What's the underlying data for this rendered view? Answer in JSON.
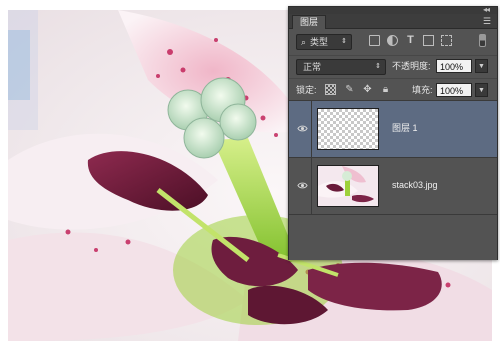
{
  "layers_panel": {
    "tab_label": "图层",
    "filter": {
      "type_label": "类型"
    },
    "blend_mode": "正常",
    "opacity_label": "不透明度:",
    "opacity_value": "100%",
    "lock_label": "锁定:",
    "fill_label": "填充:",
    "fill_value": "100%",
    "layers": [
      {
        "name": "图层 1",
        "selected": true,
        "visible": true,
        "thumbnail": "transparent-checkerboard"
      },
      {
        "name": "stack03.jpg",
        "selected": false,
        "visible": true,
        "thumbnail": "lily-photo"
      }
    ]
  },
  "colors": {
    "panel_bg": "#535353",
    "panel_dark": "#3a3a3a",
    "selected_layer": "#5d6b82"
  }
}
